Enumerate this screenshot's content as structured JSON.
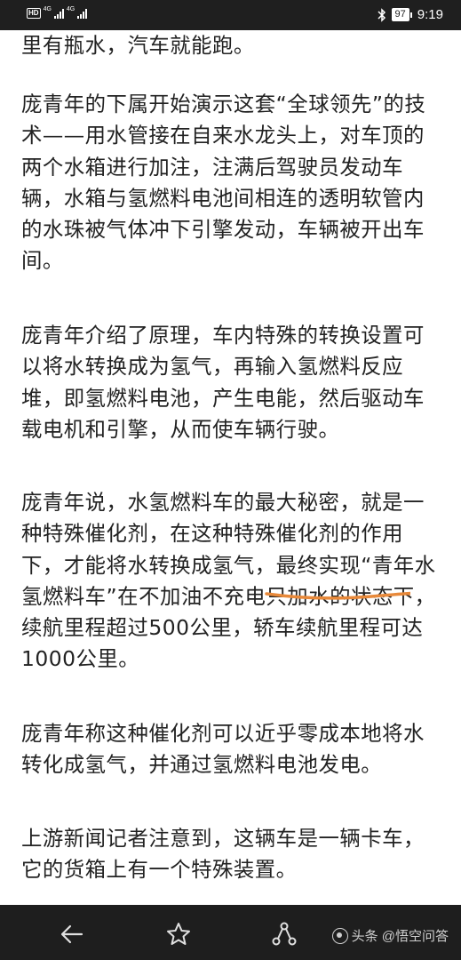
{
  "status_bar": {
    "hd_label": "HD",
    "sim1_network": "4G",
    "sim2_network": "4G",
    "battery_level": "97",
    "time": "9:19"
  },
  "article": {
    "paragraphs": [
      "里有瓶水，汽车就能跑。",
      "庞青年的下属开始演示这套“全球领先”的技术——用水管接在自来水龙头上，对车顶的两个水箱进行加注，注满后驾驶员发动车辆，水箱与氢燃料电池间相连的透明软管内的水珠被气体冲下引擎发动，车辆被开出车间。",
      "庞青年介绍了原理，车内特殊的转换设置可以将水转换成为氢气，再输入氢燃料反应堆，即氢燃料电池，产生电能，然后驱动车载电机和引擎，从而使车辆行驶。",
      "庞青年说，水氢燃料车的最大秘密，就是一种特殊催化剂，在这种特殊催化剂的作用下，才能将水转换成氢气，最终实现“青年水氢燃料车”在不加油不充电只加水的状态下，续航里程超过500公里，轿车续航里程可达1000公里。",
      "庞青年称这种催化剂可以近乎零成本地将水转化成氢气，并通过氢燃料电池发电。",
      "上游新闻记者注意到，这辆车是一辆卡车，它的货箱上有一个特殊装置。"
    ]
  },
  "annotation": {
    "underline_color": "#e8893a"
  },
  "bottom_nav": {
    "watermark": "头条 @悟空问答"
  }
}
